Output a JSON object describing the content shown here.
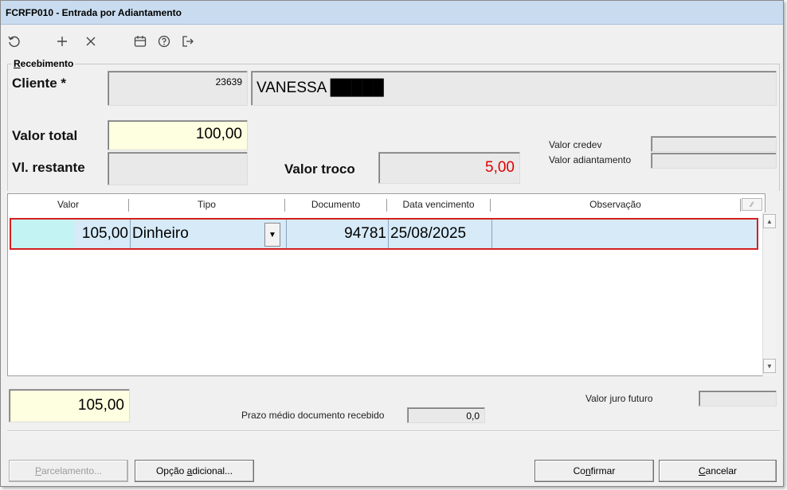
{
  "window": {
    "title": "FCRFP010 - Entrada por Adiantamento"
  },
  "toolbar": {
    "icons": [
      "undo-icon",
      "add-icon",
      "close-icon",
      "calendar-icon",
      "help-icon",
      "exit-icon"
    ]
  },
  "group": {
    "label_first": "R",
    "label_rest": "ecebimento"
  },
  "cliente": {
    "label": "Cliente *",
    "code": "23639",
    "name": "VANESSA █████"
  },
  "valor_total": {
    "label": "Valor total",
    "value": "100,00"
  },
  "vl_restante": {
    "label": "Vl. restante",
    "value": ""
  },
  "valor_troco": {
    "label": "Valor troco",
    "value": "5,00",
    "color": "#e00000"
  },
  "valor_credev": {
    "label": "Valor credev",
    "value": ""
  },
  "valor_adiantamento": {
    "label": "Valor adiantamento",
    "value": ""
  },
  "grid": {
    "columns": [
      "Valor",
      "Tipo",
      "Documento",
      "Data vencimento",
      "Observação"
    ],
    "rows": [
      {
        "valor": "105,00",
        "tipo": "Dinheiro",
        "documento": "94781",
        "data_vencimento": "25/08/2025",
        "observacao": ""
      }
    ],
    "corner_label": "∕∕"
  },
  "total_field": {
    "value": "105,00"
  },
  "prazo": {
    "label": "Prazo médio documento recebido",
    "value": "0,0"
  },
  "juro": {
    "label": "Valor juro futuro",
    "value": ""
  },
  "buttons": {
    "parcelamento": {
      "ul": "P",
      "rest": "arcelamento..."
    },
    "opcao": {
      "pre": "Opção ",
      "ul": "a",
      "rest": "dicional..."
    },
    "confirmar": {
      "pre": "Co",
      "ul": "n",
      "rest": "firmar"
    },
    "cancelar": {
      "ul": "C",
      "rest": "ancelar"
    }
  },
  "colors": {
    "accent": "#c9dcef",
    "highlight": "#fefee0",
    "selection_border": "#d42020",
    "row_bg": "#d6eaf8"
  }
}
